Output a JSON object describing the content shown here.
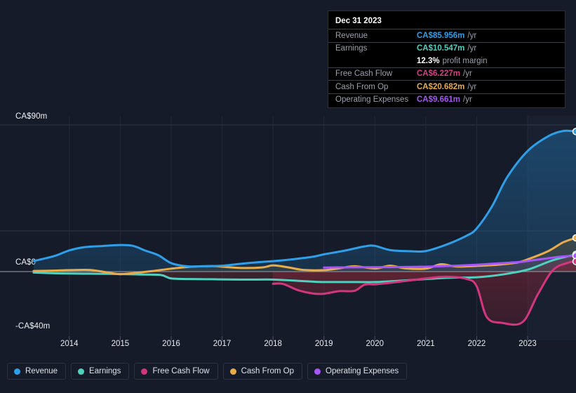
{
  "theme": {
    "background": "#151b28",
    "grid_color": "#39404e",
    "zero_line_color": "#9aa0ab",
    "tooltip_bg": "#000000",
    "tooltip_border": "#2a2f3a",
    "axis_text": "#e8eaee",
    "muted_text": "#9aa0ab"
  },
  "tooltip": {
    "date": "Dec 31 2023",
    "rows": [
      {
        "name": "Revenue",
        "value": "CA$85.956m",
        "unit": "/yr",
        "color": "#2e9fe8"
      },
      {
        "name": "Earnings",
        "value": "CA$10.547m",
        "unit": "/yr",
        "color": "#4fd1c0"
      },
      {
        "name": "",
        "value": "12.3%",
        "unit": "profit margin",
        "color": "#ffffff"
      },
      {
        "name": "Free Cash Flow",
        "value": "CA$6.227m",
        "unit": "/yr",
        "color": "#d83f86"
      },
      {
        "name": "Cash From Op",
        "value": "CA$20.682m",
        "unit": "/yr",
        "color": "#e8ac4a"
      },
      {
        "name": "Operating Expenses",
        "value": "CA$9.661m",
        "unit": "/yr",
        "color": "#a855f7"
      }
    ]
  },
  "legend": {
    "items": [
      {
        "label": "Revenue",
        "color": "#2e9fe8"
      },
      {
        "label": "Earnings",
        "color": "#4fd1c0"
      },
      {
        "label": "Free Cash Flow",
        "color": "#d1367f"
      },
      {
        "label": "Cash From Op",
        "color": "#e8ac4a"
      },
      {
        "label": "Operating Expenses",
        "color": "#a855f7"
      }
    ]
  },
  "chart_data": {
    "type": "area",
    "title": "",
    "xlabel": "",
    "ylabel": "",
    "currency": "CA$",
    "units": "millions",
    "grid": true,
    "legend_position": "bottom",
    "ylim": [
      -40,
      90
    ],
    "y_ticks": [
      90,
      25,
      0,
      -40
    ],
    "y_tick_labels": [
      "CA$90m",
      "",
      "CA$0",
      "-CA$40m"
    ],
    "x_tick_labels": [
      "2014",
      "2015",
      "2016",
      "2017",
      "2018",
      "2019",
      "2020",
      "2021",
      "2022",
      "2023"
    ],
    "x_range": [
      2013.3,
      2023.95
    ],
    "forecast_start": "2023",
    "series": [
      {
        "name": "Revenue",
        "color": "#2e9fe8",
        "fill": "rgba(31,92,140,0.62)",
        "end_marker_value": 85.956,
        "x": [
          2013.3,
          2013.7,
          2014.0,
          2014.3,
          2014.6,
          2015.0,
          2015.25,
          2015.5,
          2015.75,
          2016.0,
          2016.3,
          2016.6,
          2017.0,
          2017.4,
          2017.8,
          2018.0,
          2018.4,
          2018.8,
          2019.0,
          2019.4,
          2019.8,
          2020.0,
          2020.3,
          2020.7,
          2021.0,
          2021.4,
          2021.8,
          2022.0,
          2022.3,
          2022.6,
          2023.0,
          2023.4,
          2023.7,
          2023.95
        ],
        "values": [
          6.5,
          9.5,
          13.0,
          15.0,
          15.6,
          16.3,
          15.8,
          12.8,
          10.0,
          5.2,
          3.3,
          3.2,
          3.6,
          4.9,
          6.0,
          6.4,
          7.6,
          9.2,
          10.6,
          12.8,
          15.5,
          15.8,
          13.2,
          12.5,
          12.6,
          16.5,
          22.0,
          26.5,
          40.0,
          58.0,
          74.0,
          83.0,
          86.3,
          85.956
        ]
      },
      {
        "name": "Earnings",
        "color": "#4fd1c0",
        "fill": "rgba(96,42,48,0.72)",
        "end_marker_value": 10.547,
        "x": [
          2013.3,
          2013.7,
          2014.0,
          2014.4,
          2014.8,
          2015.0,
          2015.4,
          2015.8,
          2016.0,
          2016.4,
          2016.8,
          2017.0,
          2017.5,
          2018.0,
          2018.4,
          2018.8,
          2019.0,
          2019.5,
          2020.0,
          2020.5,
          2021.0,
          2021.5,
          2022.0,
          2022.5,
          2023.0,
          2023.5,
          2023.95
        ],
        "values": [
          -0.6,
          -1.0,
          -1.2,
          -1.3,
          -1.4,
          -1.5,
          -1.8,
          -2.1,
          -4.2,
          -4.6,
          -4.7,
          -4.8,
          -4.9,
          -4.9,
          -5.5,
          -6.2,
          -6.4,
          -6.4,
          -6.4,
          -5.6,
          -4.6,
          -3.7,
          -3.5,
          -1.8,
          1.2,
          7.0,
          10.547
        ]
      },
      {
        "name": "Free Cash Flow",
        "color": "#d1367f",
        "fill": "rgba(112,36,54,0.66)",
        "end_marker_value": 6.227,
        "x": [
          2018.0,
          2018.2,
          2018.5,
          2018.8,
          2019.0,
          2019.3,
          2019.6,
          2019.8,
          2020.0,
          2020.4,
          2020.8,
          2021.0,
          2021.4,
          2021.8,
          2022.0,
          2022.2,
          2022.5,
          2022.9,
          2023.2,
          2023.5,
          2023.8,
          2023.95
        ],
        "values": [
          -7.5,
          -7.6,
          -11.5,
          -13.5,
          -13.6,
          -12.0,
          -11.8,
          -8.0,
          -7.8,
          -6.5,
          -5.0,
          -4.2,
          -3.2,
          -4.5,
          -9.0,
          -28.0,
          -31.5,
          -31.0,
          -14.0,
          1.0,
          5.5,
          6.227
        ]
      },
      {
        "name": "Cash From Op",
        "color": "#e8ac4a",
        "fill": "rgba(90,88,64,0.50)",
        "end_marker_value": 20.682,
        "x": [
          2013.3,
          2013.7,
          2014.0,
          2014.4,
          2014.8,
          2015.0,
          2015.3,
          2015.6,
          2016.0,
          2016.4,
          2016.8,
          2017.0,
          2017.4,
          2017.8,
          2018.0,
          2018.3,
          2018.6,
          2019.0,
          2019.3,
          2019.6,
          2020.0,
          2020.3,
          2020.6,
          2021.0,
          2021.3,
          2021.6,
          2022.0,
          2022.4,
          2022.8,
          2023.0,
          2023.4,
          2023.7,
          2023.95
        ],
        "values": [
          0.4,
          0.6,
          0.9,
          1.0,
          -0.8,
          -1.6,
          -0.8,
          0.2,
          1.8,
          3.0,
          3.4,
          3.0,
          2.2,
          2.6,
          3.8,
          2.6,
          1.0,
          0.9,
          2.0,
          3.3,
          1.9,
          3.6,
          2.0,
          1.8,
          4.5,
          3.1,
          3.5,
          4.2,
          5.6,
          7.5,
          12.5,
          18.0,
          20.682
        ]
      },
      {
        "name": "Operating Expenses",
        "color": "#a855f7",
        "fill": "rgba(98,78,140,0.34)",
        "end_marker_value": 9.661,
        "x": [
          2019.0,
          2019.4,
          2019.8,
          2020.0,
          2020.5,
          2021.0,
          2021.5,
          2022.0,
          2022.4,
          2022.8,
          2023.0,
          2023.4,
          2023.7,
          2023.95
        ],
        "values": [
          2.5,
          2.6,
          2.7,
          2.7,
          2.8,
          3.0,
          3.5,
          4.2,
          5.0,
          5.8,
          6.5,
          8.2,
          9.3,
          9.661
        ]
      }
    ]
  }
}
